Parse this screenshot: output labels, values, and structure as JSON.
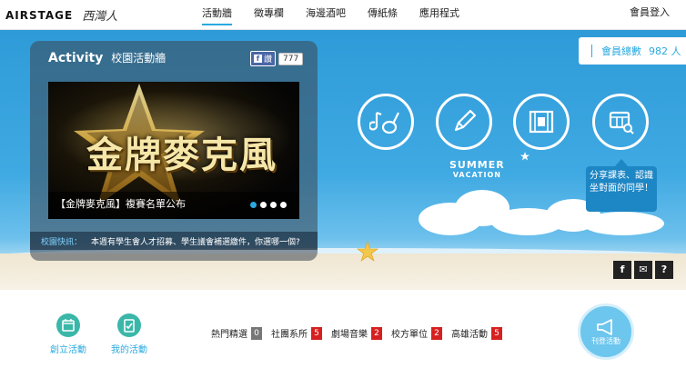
{
  "header": {
    "logo_main": "AIRSTAGE",
    "logo_script": "西灣人",
    "nav": [
      {
        "label": "活動牆",
        "active": true
      },
      {
        "label": "徵專欄",
        "active": false
      },
      {
        "label": "海邊酒吧",
        "active": false
      },
      {
        "label": "傳紙條",
        "active": false
      },
      {
        "label": "應用程式",
        "active": false
      }
    ],
    "login": "會員登入"
  },
  "member": {
    "label": "會員總數",
    "count": "982 人"
  },
  "activity": {
    "title": "Activity",
    "subtitle": "校園活動牆",
    "fb_label": "讚",
    "fb_count": "777",
    "banner_art": "金牌麥克風",
    "banner_caption": "【金牌麥克風】複賽名單公布",
    "dots": 4,
    "active_dot": 0
  },
  "ticker": {
    "label": "校園快訊：",
    "text": "本週有學生會人才招募、學生議會補選繳件，你選哪一個?"
  },
  "summer": {
    "line1": "SUMMER",
    "line2": "VACATION"
  },
  "bubble": {
    "text": "分享課表、認識坐對面的同學！"
  },
  "share": {
    "facebook": "f",
    "mail": "✉",
    "help": "?"
  },
  "quick": [
    {
      "label": "創立活動"
    },
    {
      "label": "我的活動"
    }
  ],
  "categories": [
    {
      "label": "熱門精選",
      "count": "0",
      "color": "#777777"
    },
    {
      "label": "社團系所",
      "count": "5",
      "color": "#d62020"
    },
    {
      "label": "劇場音樂",
      "count": "2",
      "color": "#d62020"
    },
    {
      "label": "校方單位",
      "count": "2",
      "color": "#d62020"
    },
    {
      "label": "高雄活動",
      "count": "5",
      "color": "#d62020"
    }
  ],
  "create_button": {
    "label": "刊登活動"
  },
  "colors": {
    "accent": "#2aa9e0",
    "teal": "#3ab7a8",
    "badge_red": "#d62020"
  }
}
